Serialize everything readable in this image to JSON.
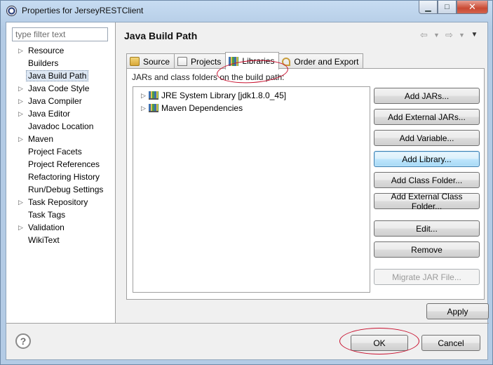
{
  "window": {
    "title": "Properties for JerseyRESTClient",
    "controls": {
      "minimize": "▁",
      "maximize": "□",
      "close": "✕"
    }
  },
  "filter": {
    "placeholder": "type filter text",
    "value": ""
  },
  "nav": {
    "items": [
      {
        "label": "Resource",
        "expandable": true
      },
      {
        "label": "Builders",
        "expandable": false
      },
      {
        "label": "Java Build Path",
        "expandable": false,
        "selected": true
      },
      {
        "label": "Java Code Style",
        "expandable": true
      },
      {
        "label": "Java Compiler",
        "expandable": true
      },
      {
        "label": "Java Editor",
        "expandable": true
      },
      {
        "label": "Javadoc Location",
        "expandable": false
      },
      {
        "label": "Maven",
        "expandable": true
      },
      {
        "label": "Project Facets",
        "expandable": false
      },
      {
        "label": "Project References",
        "expandable": false
      },
      {
        "label": "Refactoring History",
        "expandable": false
      },
      {
        "label": "Run/Debug Settings",
        "expandable": false
      },
      {
        "label": "Task Repository",
        "expandable": true
      },
      {
        "label": "Task Tags",
        "expandable": false
      },
      {
        "label": "Validation",
        "expandable": true
      },
      {
        "label": "WikiText",
        "expandable": false
      }
    ]
  },
  "page": {
    "title": "Java Build Path",
    "tabs": [
      {
        "label": "Source",
        "icon": "source-folder-icon"
      },
      {
        "label": "Projects",
        "icon": "projects-icon"
      },
      {
        "label": "Libraries",
        "icon": "libraries-icon",
        "active": true
      },
      {
        "label": "Order and Export",
        "icon": "order-export-icon"
      }
    ],
    "section_label": "JARs and class folders on the build path:",
    "tree": [
      {
        "label": "JRE System Library [jdk1.8.0_45]"
      },
      {
        "label": "Maven Dependencies"
      }
    ],
    "buttons": {
      "add_jars": "Add JARs...",
      "add_external_jars": "Add External JARs...",
      "add_variable": "Add Variable...",
      "add_library": "Add Library...",
      "add_class_folder": "Add Class Folder...",
      "add_external_class_folder": "Add External Class Folder...",
      "edit": "Edit...",
      "remove": "Remove",
      "migrate_jar": "Migrate JAR File..."
    },
    "apply": "Apply"
  },
  "footer": {
    "help": "?",
    "ok": "OK",
    "cancel": "Cancel"
  },
  "colors": {
    "annotation": "#c8102e",
    "selection": "#dde7f3",
    "focus_border": "#3c7fb1"
  }
}
